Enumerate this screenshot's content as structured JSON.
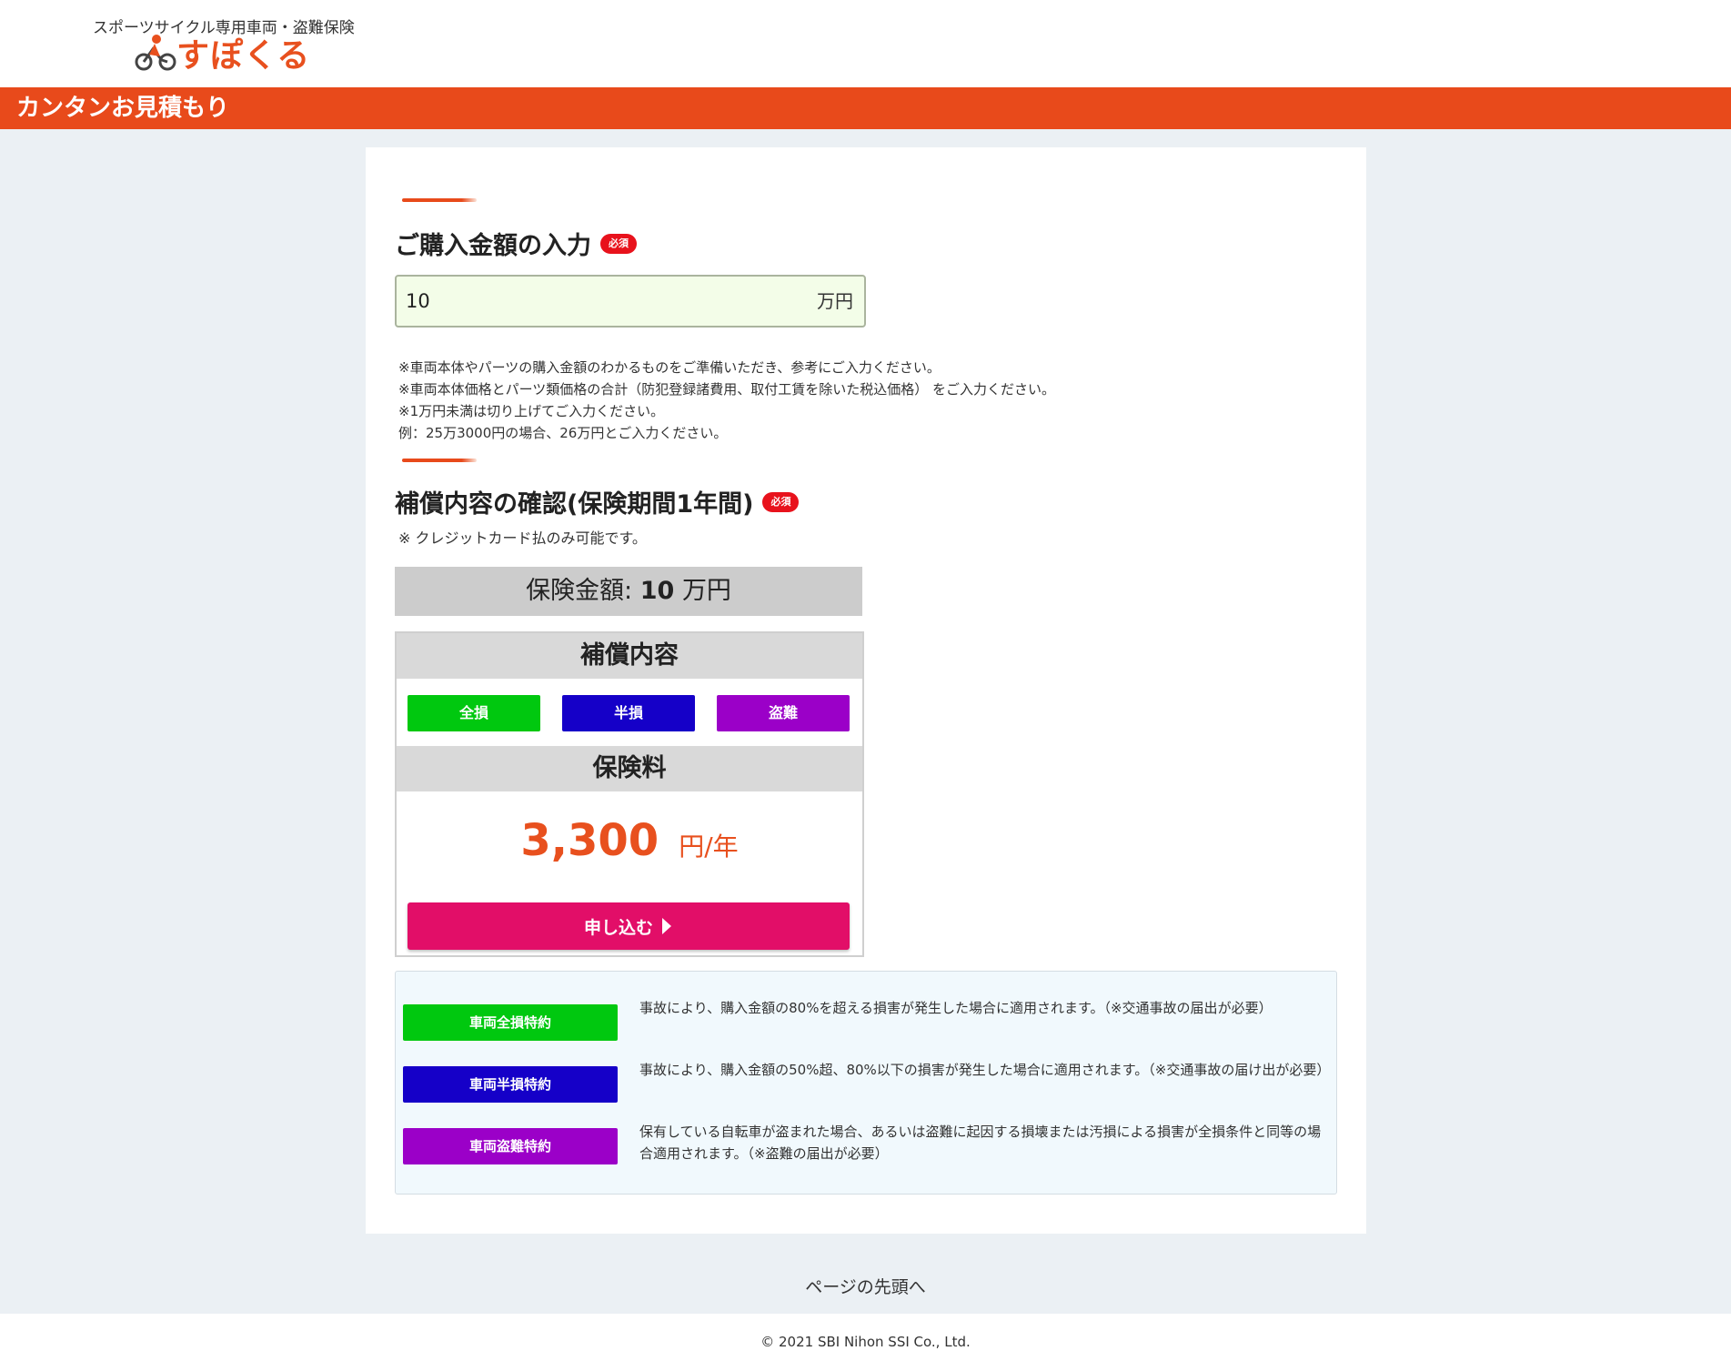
{
  "header": {
    "logo_tagline": "スポーツサイクル専用車両・盗難保険",
    "logo_name": "すぽくる",
    "page_title": "カンタンお見積もり"
  },
  "purchase": {
    "title": "ご購入金額の入力",
    "required_label": "必須",
    "amount_value": "10",
    "amount_unit": "万円",
    "notes": [
      "※車両本体やパーツの購入金額のわかるものをご準備いただき、参考にご入力ください。",
      "※車両本体価格とパーツ類価格の合計（防犯登録諸費用、取付工賃を除いた税込価格） をご入力ください。",
      "※1万円未満は切り上げてご入力ください。",
      "例：25万3000円の場合、26万円とご入力ください。"
    ]
  },
  "coverage": {
    "title": "補償内容の確認(保険期間1年間)",
    "required_label": "必須",
    "note": "※ クレジットカード払のみ可能です。",
    "sum_label": "保険金額:",
    "sum_value": "10",
    "sum_unit": "万円",
    "panel_title": "補償内容",
    "chips": [
      {
        "label": "全損",
        "color": "#00c80f"
      },
      {
        "label": "半損",
        "color": "#1500c8"
      },
      {
        "label": "盗難",
        "color": "#9b00c8"
      }
    ],
    "premium_title": "保険料",
    "premium_value": "3,300",
    "premium_unit": "円/年",
    "apply_label": "申し込む"
  },
  "legend": [
    {
      "label": "車両全損特約",
      "color": "#00c80f",
      "desc": "事故により、購入金額の80%を超える損害が発生した場合に適用されます。（※交通事故の届出が必要）"
    },
    {
      "label": "車両半損特約",
      "color": "#1500c8",
      "desc": "事故により、購入金額の50%超、80%以下の損害が発生した場合に適用されます。（※交通事故の届け出が必要）"
    },
    {
      "label": "車両盗難特約",
      "color": "#9b00c8",
      "desc": "保有している自転車が盗まれた場合、あるいは盗難に起因する損壊または汚損による損害が全損条件と同等の場合適用されます。（※盗難の届出が必要）"
    }
  ],
  "footer": {
    "page_top": "ページの先頭へ",
    "copyright": "© 2021 SBI Nihon SSI Co., Ltd."
  },
  "colors": {
    "brand_orange": "#e84a1b",
    "apply_pink": "#e20e68",
    "required_red": "#e8121c"
  }
}
